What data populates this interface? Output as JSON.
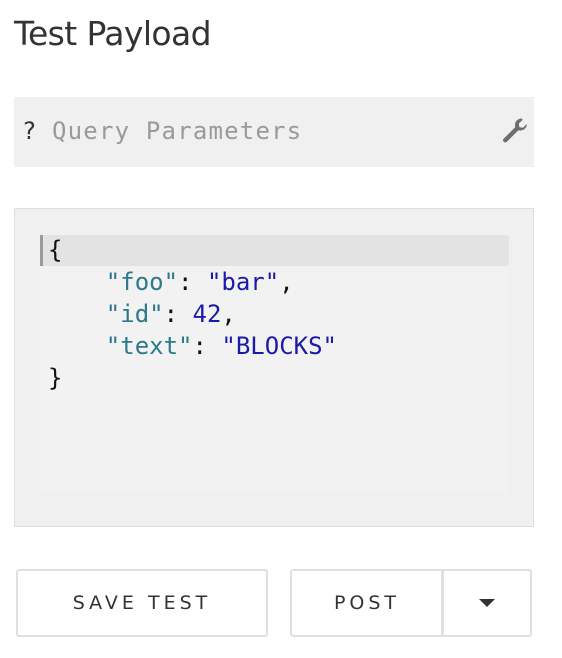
{
  "page": {
    "title": "Test Payload"
  },
  "query": {
    "prefix": "?",
    "placeholder": "Query Parameters",
    "value": "",
    "settings_icon": "wrench-icon"
  },
  "editor": {
    "language": "json",
    "lines": [
      [
        {
          "t": "punct",
          "v": "{"
        }
      ],
      [
        {
          "t": "ws",
          "v": "    "
        },
        {
          "t": "key",
          "v": "\"foo\""
        },
        {
          "t": "punct",
          "v": ": "
        },
        {
          "t": "str",
          "v": "\"bar\""
        },
        {
          "t": "punct",
          "v": ","
        }
      ],
      [
        {
          "t": "ws",
          "v": "    "
        },
        {
          "t": "key",
          "v": "\"id\""
        },
        {
          "t": "punct",
          "v": ": "
        },
        {
          "t": "num",
          "v": "42"
        },
        {
          "t": "punct",
          "v": ","
        }
      ],
      [
        {
          "t": "ws",
          "v": "    "
        },
        {
          "t": "key",
          "v": "\"text\""
        },
        {
          "t": "punct",
          "v": ": "
        },
        {
          "t": "str",
          "v": "\"BLOCKS\""
        }
      ],
      [
        {
          "t": "punct",
          "v": "}"
        }
      ]
    ],
    "colors": {
      "key": "#2b7a8a",
      "string": "#1a1aa6",
      "number": "#1a1aa6",
      "punct": "#111111"
    }
  },
  "actions": {
    "save_label": "SAVE TEST",
    "method_label": "POST",
    "method_dropdown_icon": "caret-down-icon"
  }
}
